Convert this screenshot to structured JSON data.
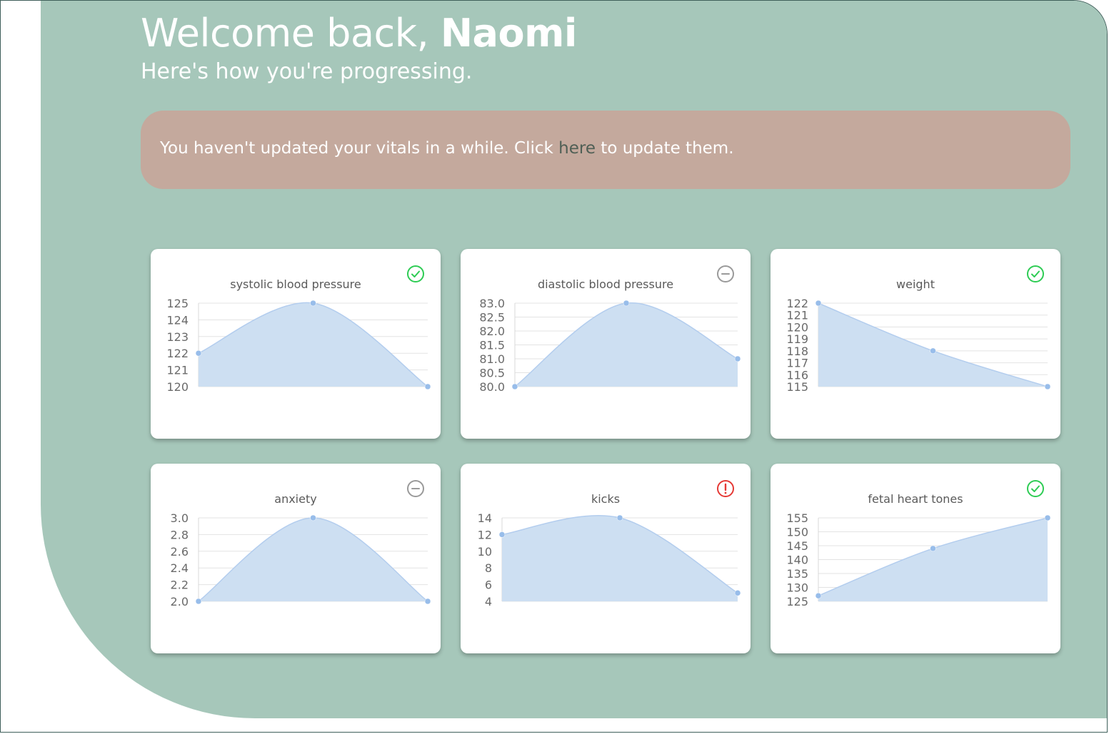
{
  "header": {
    "greeting": "Welcome back,",
    "name": "Naomi",
    "subtitle": "Here's how you're progressing."
  },
  "banner": {
    "text_before": "You haven't updated your vitals in a while. Click ",
    "link": "here",
    "text_after": " to update them."
  },
  "colors": {
    "panel": "#a6c7ba",
    "banner": "#c4a99d",
    "status_ok": "#2ecc54",
    "status_neutral": "#9a9a9a",
    "status_alert": "#e53935",
    "chart_fill": "#cddff2",
    "chart_line": "#b3cdee",
    "chart_point": "#98bdea"
  },
  "cards": [
    {
      "title": "systolic blood pressure",
      "status": "ok",
      "status_icon": "check-circle-icon"
    },
    {
      "title": "diastolic blood pressure",
      "status": "neutral",
      "status_icon": "minus-circle-icon"
    },
    {
      "title": "weight",
      "status": "ok",
      "status_icon": "check-circle-icon"
    },
    {
      "title": "anxiety",
      "status": "neutral",
      "status_icon": "minus-circle-icon"
    },
    {
      "title": "kicks",
      "status": "alert",
      "status_icon": "exclamation-circle-icon"
    },
    {
      "title": "fetal heart tones",
      "status": "ok",
      "status_icon": "check-circle-icon"
    }
  ],
  "chart_data": [
    {
      "type": "area",
      "title": "systolic blood pressure",
      "x": [
        1,
        2,
        3
      ],
      "values": [
        122,
        125,
        120
      ],
      "ylim": [
        120,
        125
      ],
      "yticks": [
        "125",
        "124",
        "123",
        "122",
        "121",
        "120"
      ],
      "grid": true
    },
    {
      "type": "area",
      "title": "diastolic blood pressure",
      "x": [
        1,
        2,
        3
      ],
      "values": [
        80,
        83,
        81
      ],
      "ylim": [
        80,
        83
      ],
      "yticks": [
        "83.0",
        "82.5",
        "82.0",
        "81.5",
        "81.0",
        "80.5",
        "80.0"
      ],
      "grid": true
    },
    {
      "type": "area",
      "title": "weight",
      "x": [
        1,
        2,
        3
      ],
      "values": [
        122,
        118,
        115
      ],
      "ylim": [
        115,
        122
      ],
      "yticks": [
        "122",
        "121",
        "120",
        "119",
        "118",
        "117",
        "116",
        "115"
      ],
      "grid": true
    },
    {
      "type": "area",
      "title": "anxiety",
      "x": [
        1,
        2,
        3
      ],
      "values": [
        2,
        3,
        2
      ],
      "ylim": [
        2,
        3
      ],
      "yticks": [
        "3.0",
        "2.8",
        "2.6",
        "2.4",
        "2.2",
        "2.0"
      ],
      "grid": true
    },
    {
      "type": "area",
      "title": "kicks",
      "x": [
        1,
        2,
        3
      ],
      "values": [
        12,
        14,
        5
      ],
      "ylim": [
        4,
        14
      ],
      "yticks": [
        "14",
        "12",
        "10",
        "8",
        "6",
        "4"
      ],
      "grid": true
    },
    {
      "type": "area",
      "title": "fetal heart tones",
      "x": [
        1,
        2,
        3
      ],
      "values": [
        127,
        144,
        155
      ],
      "ylim": [
        125,
        155
      ],
      "yticks": [
        "155",
        "150",
        "145",
        "140",
        "135",
        "130",
        "125"
      ],
      "grid": true
    }
  ]
}
